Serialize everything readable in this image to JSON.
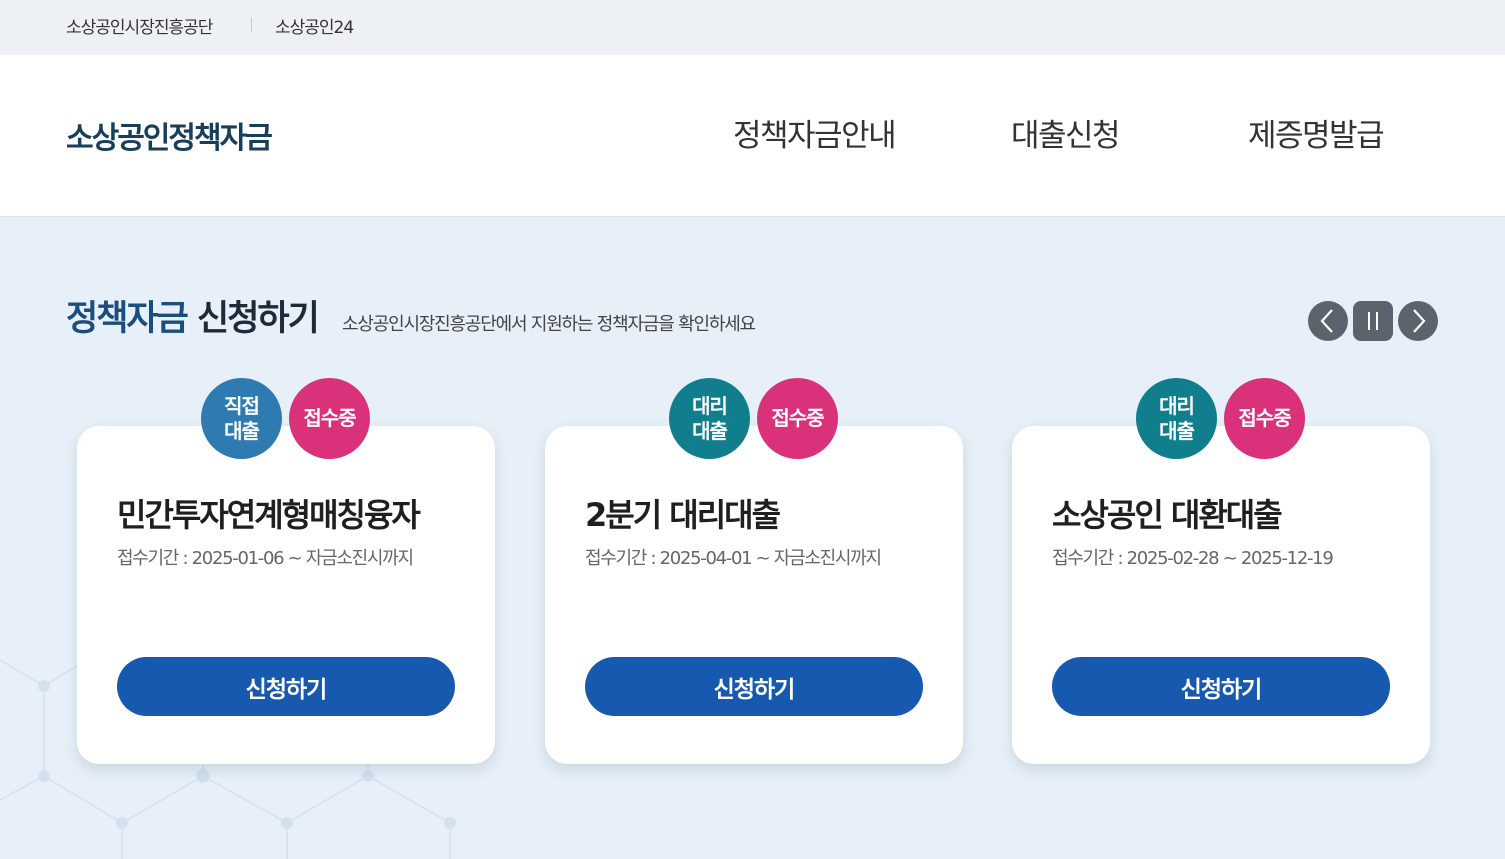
{
  "topbar": {
    "links": [
      "소상공인시장진흥공단",
      "소상공인24"
    ]
  },
  "header": {
    "logo": "소상공인정책자금",
    "nav": [
      "정책자금안내",
      "대출신청",
      "제증명발급"
    ]
  },
  "section": {
    "title_blue": "정책자금",
    "title_dark": "신청하기",
    "description": "소상공인시장진흥공단에서 지원하는 정책자금을 확인하세요"
  },
  "controls": {
    "prev_icon": "chevron-left-icon",
    "pause_icon": "pause-icon",
    "next_icon": "chevron-right-icon"
  },
  "colors": {
    "badge_direct": "#2e7bb2",
    "badge_agency": "#107e8c",
    "badge_status": "#d9317a",
    "button": "#1659ae",
    "title_blue": "#1b4e7e"
  },
  "cards": [
    {
      "type_badge": "직접\n대출",
      "status_badge": "접수중",
      "title": "민간투자연계형매칭융자",
      "period": "접수기간 : 2025-01-06 ~ 자금소진시까지",
      "button": "신청하기"
    },
    {
      "type_badge": "대리\n대출",
      "status_badge": "접수중",
      "title": "2분기 대리대출",
      "period": "접수기간 : 2025-04-01 ~ 자금소진시까지",
      "button": "신청하기"
    },
    {
      "type_badge": "대리\n대출",
      "status_badge": "접수중",
      "title": "소상공인 대환대출",
      "period": "접수기간 : 2025-02-28 ~ 2025-12-19",
      "button": "신청하기"
    }
  ]
}
